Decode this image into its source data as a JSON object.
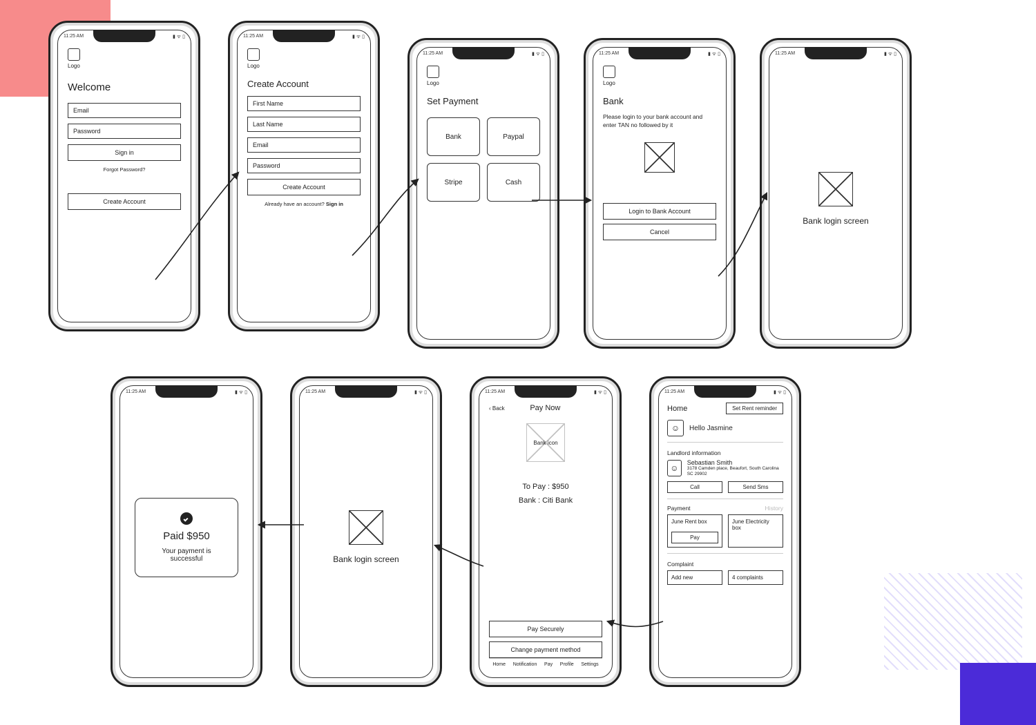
{
  "status": {
    "time": "11:25 AM",
    "icons": "▮ ᯤ ▯"
  },
  "common": {
    "logo_label": "Logo"
  },
  "s1_welcome": {
    "title": "Welcome",
    "email": "Email",
    "password": "Password",
    "signin": "Sign in",
    "forgot": "Forgot Password?",
    "create": "Create Account"
  },
  "s2_create": {
    "title": "Create Account",
    "first": "First Name",
    "last": "Last Name",
    "email": "Email",
    "password": "Password",
    "create_btn": "Create Account",
    "already": "Already have an account?",
    "signin": "Sign in"
  },
  "s3_payment": {
    "title": "Set Payment",
    "options": [
      "Bank",
      "Paypal",
      "Stripe",
      "Cash"
    ]
  },
  "s4_bank": {
    "title": "Bank",
    "instruction": "Please login to your bank account and enter TAN no followed by it",
    "login_btn": "Login to Bank Account",
    "cancel_btn": "Cancel"
  },
  "s5_banklogin": {
    "caption": "Bank login screen"
  },
  "s6_paid": {
    "headline": "Paid $950",
    "sub": "Your payment is successful"
  },
  "s7_banklogin2": {
    "caption": "Bank login screen"
  },
  "s8_paynow": {
    "back": "‹ Back",
    "title": "Pay Now",
    "icon_label": "Bank icon",
    "to_pay": "To Pay : $950",
    "bank": "Bank : Citi Bank",
    "pay_btn": "Pay Securely",
    "change_btn": "Change payment method",
    "tabs": [
      "Home",
      "Notification",
      "Pay",
      "Profile",
      "Settings"
    ]
  },
  "s9_home": {
    "title": "Home",
    "reminder_btn": "Set Rent reminder",
    "greeting": "Hello Jasmine",
    "landlord_label": "Landlord information",
    "landlord_name": "Sebastian Smith",
    "landlord_addr": "3178 Camden place, Beaufort, South Carolina SC 29902",
    "call_btn": "Call",
    "sms_btn": "Send Sms",
    "payment_label": "Payment",
    "history_label": "History",
    "rent_box": "June Rent box",
    "elec_box": "June Electricity box",
    "pay_btn": "Pay",
    "complaint_label": "Complaint",
    "complaint_new": "Add new",
    "complaint_count": "4 complaints"
  }
}
